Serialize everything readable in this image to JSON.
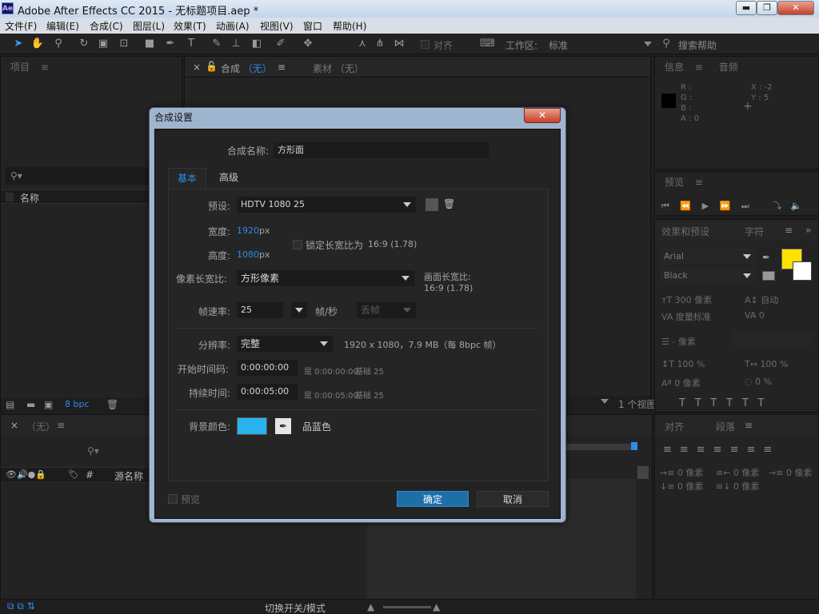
{
  "window": {
    "title": "Adobe After Effects CC 2015 - 无标题项目.aep *",
    "logo": "Ae",
    "min": "▬",
    "max": "❐",
    "close": "✕"
  },
  "menu": [
    "文件(F)",
    "编辑(E)",
    "合成(C)",
    "图层(L)",
    "效果(T)",
    "动画(A)",
    "视图(V)",
    "窗口",
    "帮助(H)"
  ],
  "toolbar": {
    "snap": "对齐",
    "workspace_label": "工作区:",
    "workspace_value": "标准",
    "search_placeholder": "搜索帮助"
  },
  "project_panel": {
    "title": "项目",
    "col_name": "名称",
    "bpc": "8 bpc"
  },
  "comp_panel": {
    "tab_comp": "合成",
    "tab_comp_value": "（无）",
    "tab_footage": "素材",
    "tab_footage_value": "（无）",
    "views": "1 个视图"
  },
  "info_panel": {
    "tab_info": "信息",
    "tab_audio": "音频",
    "r": "R :",
    "g": "G :",
    "b": "B :",
    "a": "A : 0",
    "x": "X : -2",
    "y": "Y : 5"
  },
  "preview_panel": {
    "title": "预览"
  },
  "effects_panel": {
    "tab_effects": "效果和预设",
    "tab_char": "字符",
    "font": "Arial",
    "style": "Black",
    "size": "300 像素",
    "leading": "自动",
    "kerning": "度量标准",
    "tracking": "0",
    "stroke": "- 像素",
    "vscale": "100 %",
    "hscale": "100 %",
    "baseline": "0 像素",
    "tsume": "0 %",
    "fill_color": "#ffe100"
  },
  "para_panel": {
    "tab_align": "对齐",
    "tab_para": "段落",
    "v1": "0 像素",
    "v2": "0 像素",
    "v3": "0 像素",
    "v4": "0 像素",
    "v5": "0 像素"
  },
  "timeline": {
    "title": "（无）",
    "col_num": "#",
    "col_source": "源名称",
    "toggle": "切换开关/模式"
  },
  "dialog": {
    "title": "合成设置",
    "name_label": "合成名称:",
    "name_value": "方形面",
    "tab_basic": "基本",
    "tab_advanced": "高级",
    "preset_label": "预设:",
    "preset_value": "HDTV 1080 25",
    "width_label": "宽度:",
    "width_value": "1920",
    "height_label": "高度:",
    "height_value": "1080",
    "px": "px",
    "lock_label": "锁定长宽比为",
    "lock_ratio": "16:9 (1.78)",
    "pixel_aspect_label": "像素长宽比:",
    "pixel_aspect_value": "方形像素",
    "frame_aspect_label": "画面长宽比:",
    "frame_aspect_value": "16:9 (1.78)",
    "fps_label": "帧速率:",
    "fps_value": "25",
    "fps_unit": "帧/秒",
    "drop_frame": "丢帧",
    "res_label": "分辨率:",
    "res_value": "完整",
    "res_info": "1920 x 1080，7.9 MB（每 8bpc 帧）",
    "start_label": "开始时间码:",
    "start_value": "0:00:00:00",
    "start_info": "是 0:00:00:00",
    "start_base": "基础 25",
    "dur_label": "持续时间:",
    "dur_value": "0:00:05:00",
    "dur_info": "是 0:00:05:00",
    "dur_base": "基础 25",
    "bg_label": "背景颜色:",
    "bg_color": "#29b3ec",
    "bg_name": "品蓝色",
    "preview_label": "预览",
    "ok": "确定",
    "cancel": "取消"
  }
}
